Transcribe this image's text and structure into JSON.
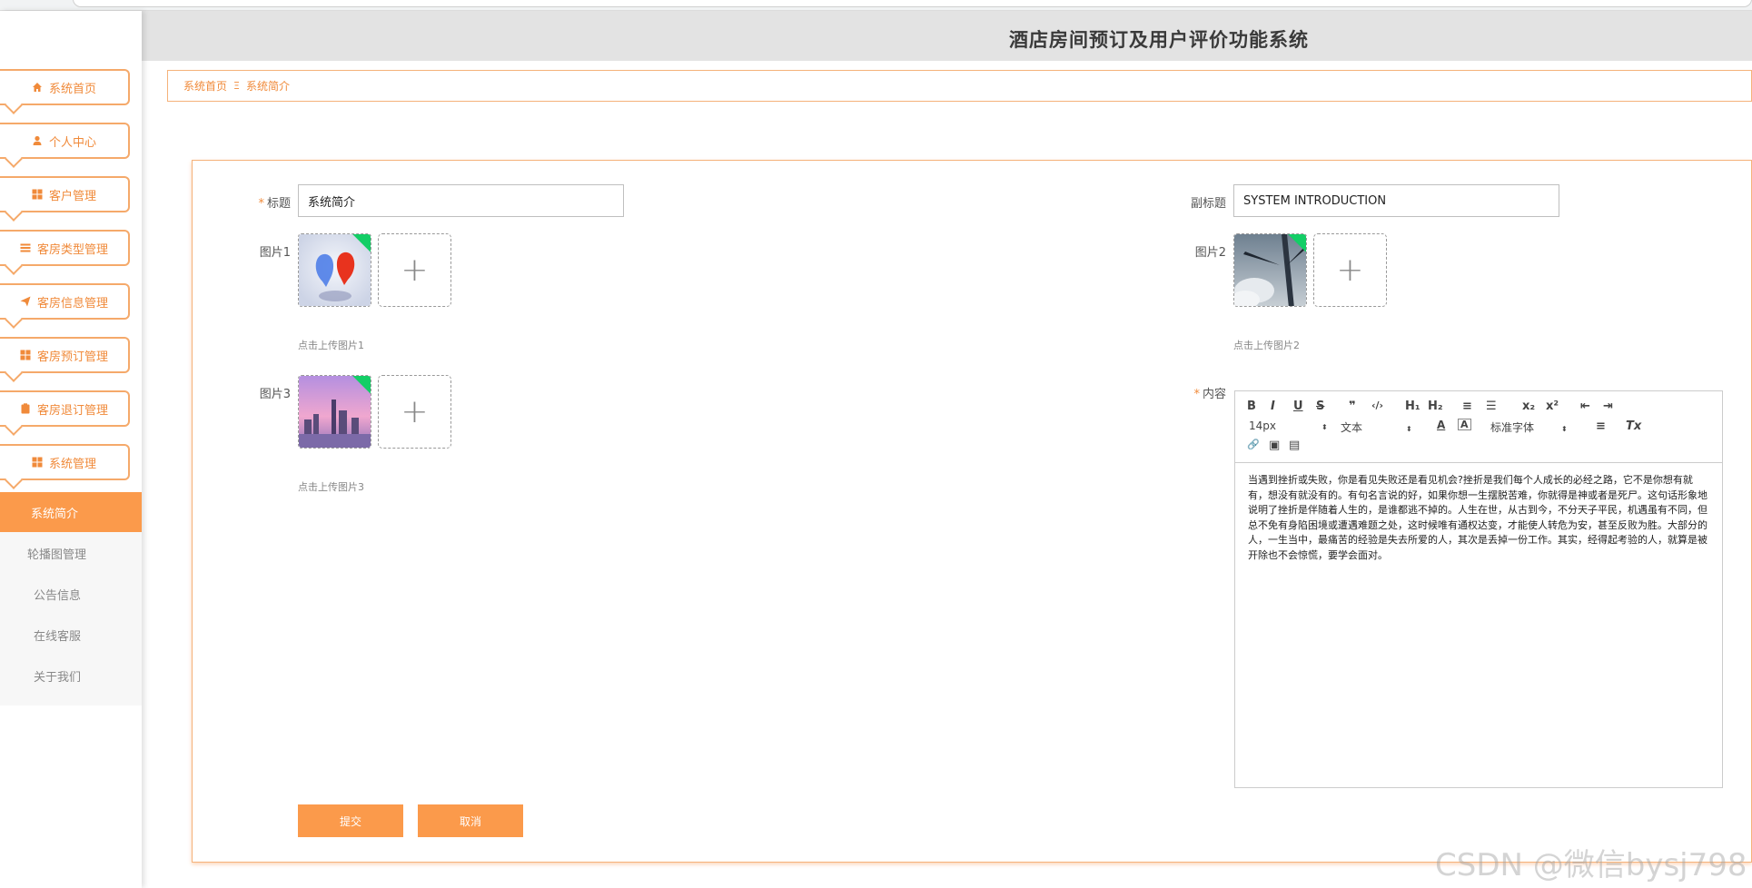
{
  "app": {
    "title": "酒店房间预订及用户评价功能系统"
  },
  "sidebar": {
    "menus": [
      {
        "label": "系统首页",
        "icon": "home-icon"
      },
      {
        "label": "个人中心",
        "icon": "user-icon"
      },
      {
        "label": "客户管理",
        "icon": "grid-icon"
      },
      {
        "label": "客房类型管理",
        "icon": "list-icon"
      },
      {
        "label": "客房信息管理",
        "icon": "send-icon"
      },
      {
        "label": "客房预订管理",
        "icon": "grid-icon"
      },
      {
        "label": "客房退订管理",
        "icon": "clipboard-icon"
      },
      {
        "label": "系统管理",
        "icon": "grid-icon"
      }
    ],
    "submenu": [
      {
        "label": "系统简介",
        "active": true
      },
      {
        "label": "轮播图管理",
        "active": false
      },
      {
        "label": "公告信息",
        "active": false
      },
      {
        "label": "在线客服",
        "active": false
      },
      {
        "label": "关于我们",
        "active": false
      }
    ]
  },
  "breadcrumb": {
    "home": "系统首页",
    "separator": "Ξ",
    "current": "系统简介"
  },
  "form": {
    "title_label": "标题",
    "title_value": "系统简介",
    "subtitle_label": "副标题",
    "subtitle_value": "SYSTEM INTRODUCTION",
    "image1_label": "图片1",
    "image1_hint": "点击上传图片1",
    "image2_label": "图片2",
    "image2_hint": "点击上传图片2",
    "image3_label": "图片3",
    "image3_hint": "点击上传图片3",
    "content_label": "内容",
    "required_mark": "*",
    "plus_glyph": "+",
    "submit_label": "提交",
    "cancel_label": "取消"
  },
  "editor": {
    "toolbar": {
      "bold": "B",
      "italic": "I",
      "underline": "U",
      "strike": "S",
      "quote": "❞",
      "code": "‹/›",
      "h1": "H₁",
      "h2": "H₂",
      "ordered_list": "≡",
      "bullet_list": "☰",
      "subscript": "x₂",
      "superscript": "x²",
      "outdent": "⇤",
      "indent": "⇥",
      "size": "14px",
      "header": "文本",
      "font_color": "A",
      "background_color": "A",
      "font_family": "标准字体",
      "align": "≡",
      "clean": "Tx",
      "link": "🔗",
      "image": "▣",
      "video": "▤",
      "select_arrow": "⬍"
    },
    "content": "当遇到挫折或失败，你是看见失败还是看见机会?挫折是我们每个人成长的必经之路，它不是你想有就有，想没有就没有的。有句名言说的好，如果你想一生摆脱苦难，你就得是神或者是死尸。这句话形象地说明了挫折是伴随着人生的，是谁都逃不掉的。人生在世，从古到今，不分天子平民，机遇虽有不同，但总不免有身陷困境或遭遇难题之处，这时候唯有通权达变，才能使人转危为安，甚至反败为胜。大部分的人，一生当中，最痛苦的经验是失去所爱的人，其次是丢掉一份工作。其实，经得起考验的人，就算是被开除也不会惊慌，要学会面对。"
  },
  "watermark": "CSDN @微信bysj798",
  "colors": {
    "accent": "#fb9a4b",
    "border": "#f5b27a",
    "success": "#13ce66"
  }
}
